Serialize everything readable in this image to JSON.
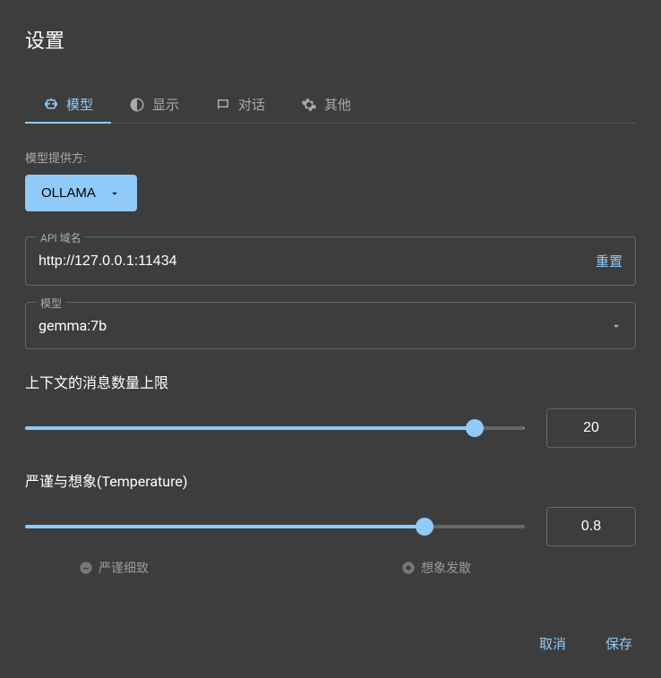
{
  "title": "设置",
  "tabs": {
    "model": "模型",
    "display": "显示",
    "chat": "对话",
    "other": "其他"
  },
  "provider": {
    "label": "模型提供方:",
    "value": "OLLAMA"
  },
  "apiDomain": {
    "label": "API 域名",
    "value": "http://127.0.0.1:11434",
    "reset": "重置"
  },
  "model": {
    "label": "模型",
    "value": "gemma:7b"
  },
  "contextLimit": {
    "label": "上下文的消息数量上限",
    "value": "20",
    "fillPercent": 90
  },
  "temperature": {
    "label": "严谨与想象(Temperature)",
    "value": "0.8",
    "fillPercent": 80,
    "lowLabel": "严谨细致",
    "highLabel": "想象发散"
  },
  "actions": {
    "cancel": "取消",
    "save": "保存"
  }
}
